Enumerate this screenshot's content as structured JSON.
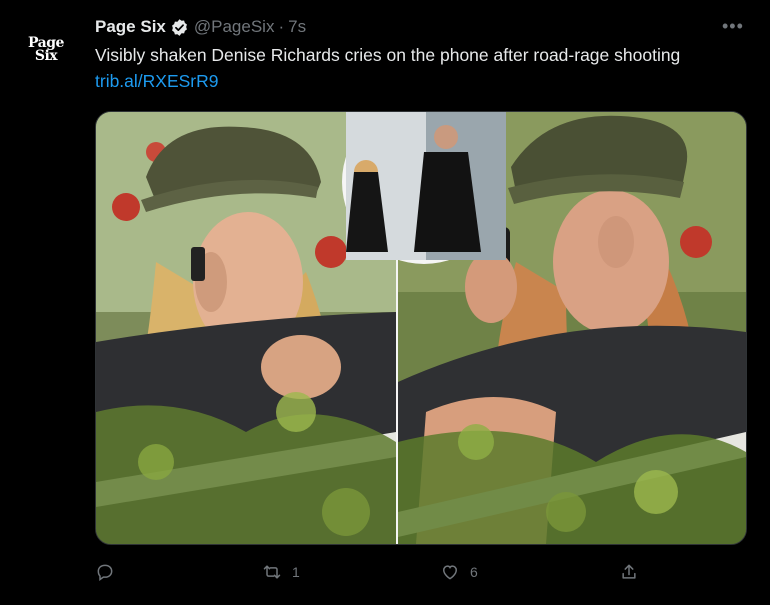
{
  "account": {
    "logo_text_line1": "Page",
    "logo_text_line2": "Six",
    "name": "Page Six",
    "handle": "@PageSix",
    "separator": "·",
    "time": "7s"
  },
  "tweet": {
    "text": "Visibly shaken Denise Richards cries on the phone after road-rage shooting",
    "link": "trib.al/RXESrR9"
  },
  "actions": {
    "reply_count": "",
    "retweet_count": "1",
    "like_count": "6",
    "share_count": ""
  },
  "icons": {
    "more": "more-dots-icon",
    "verified": "verified-badge-icon",
    "reply": "reply-icon",
    "retweet": "retweet-icon",
    "like": "heart-icon",
    "share": "share-icon"
  },
  "colors": {
    "background": "#000000",
    "text": "#e7e9ea",
    "muted": "#71767b",
    "link": "#1d9bf0"
  }
}
